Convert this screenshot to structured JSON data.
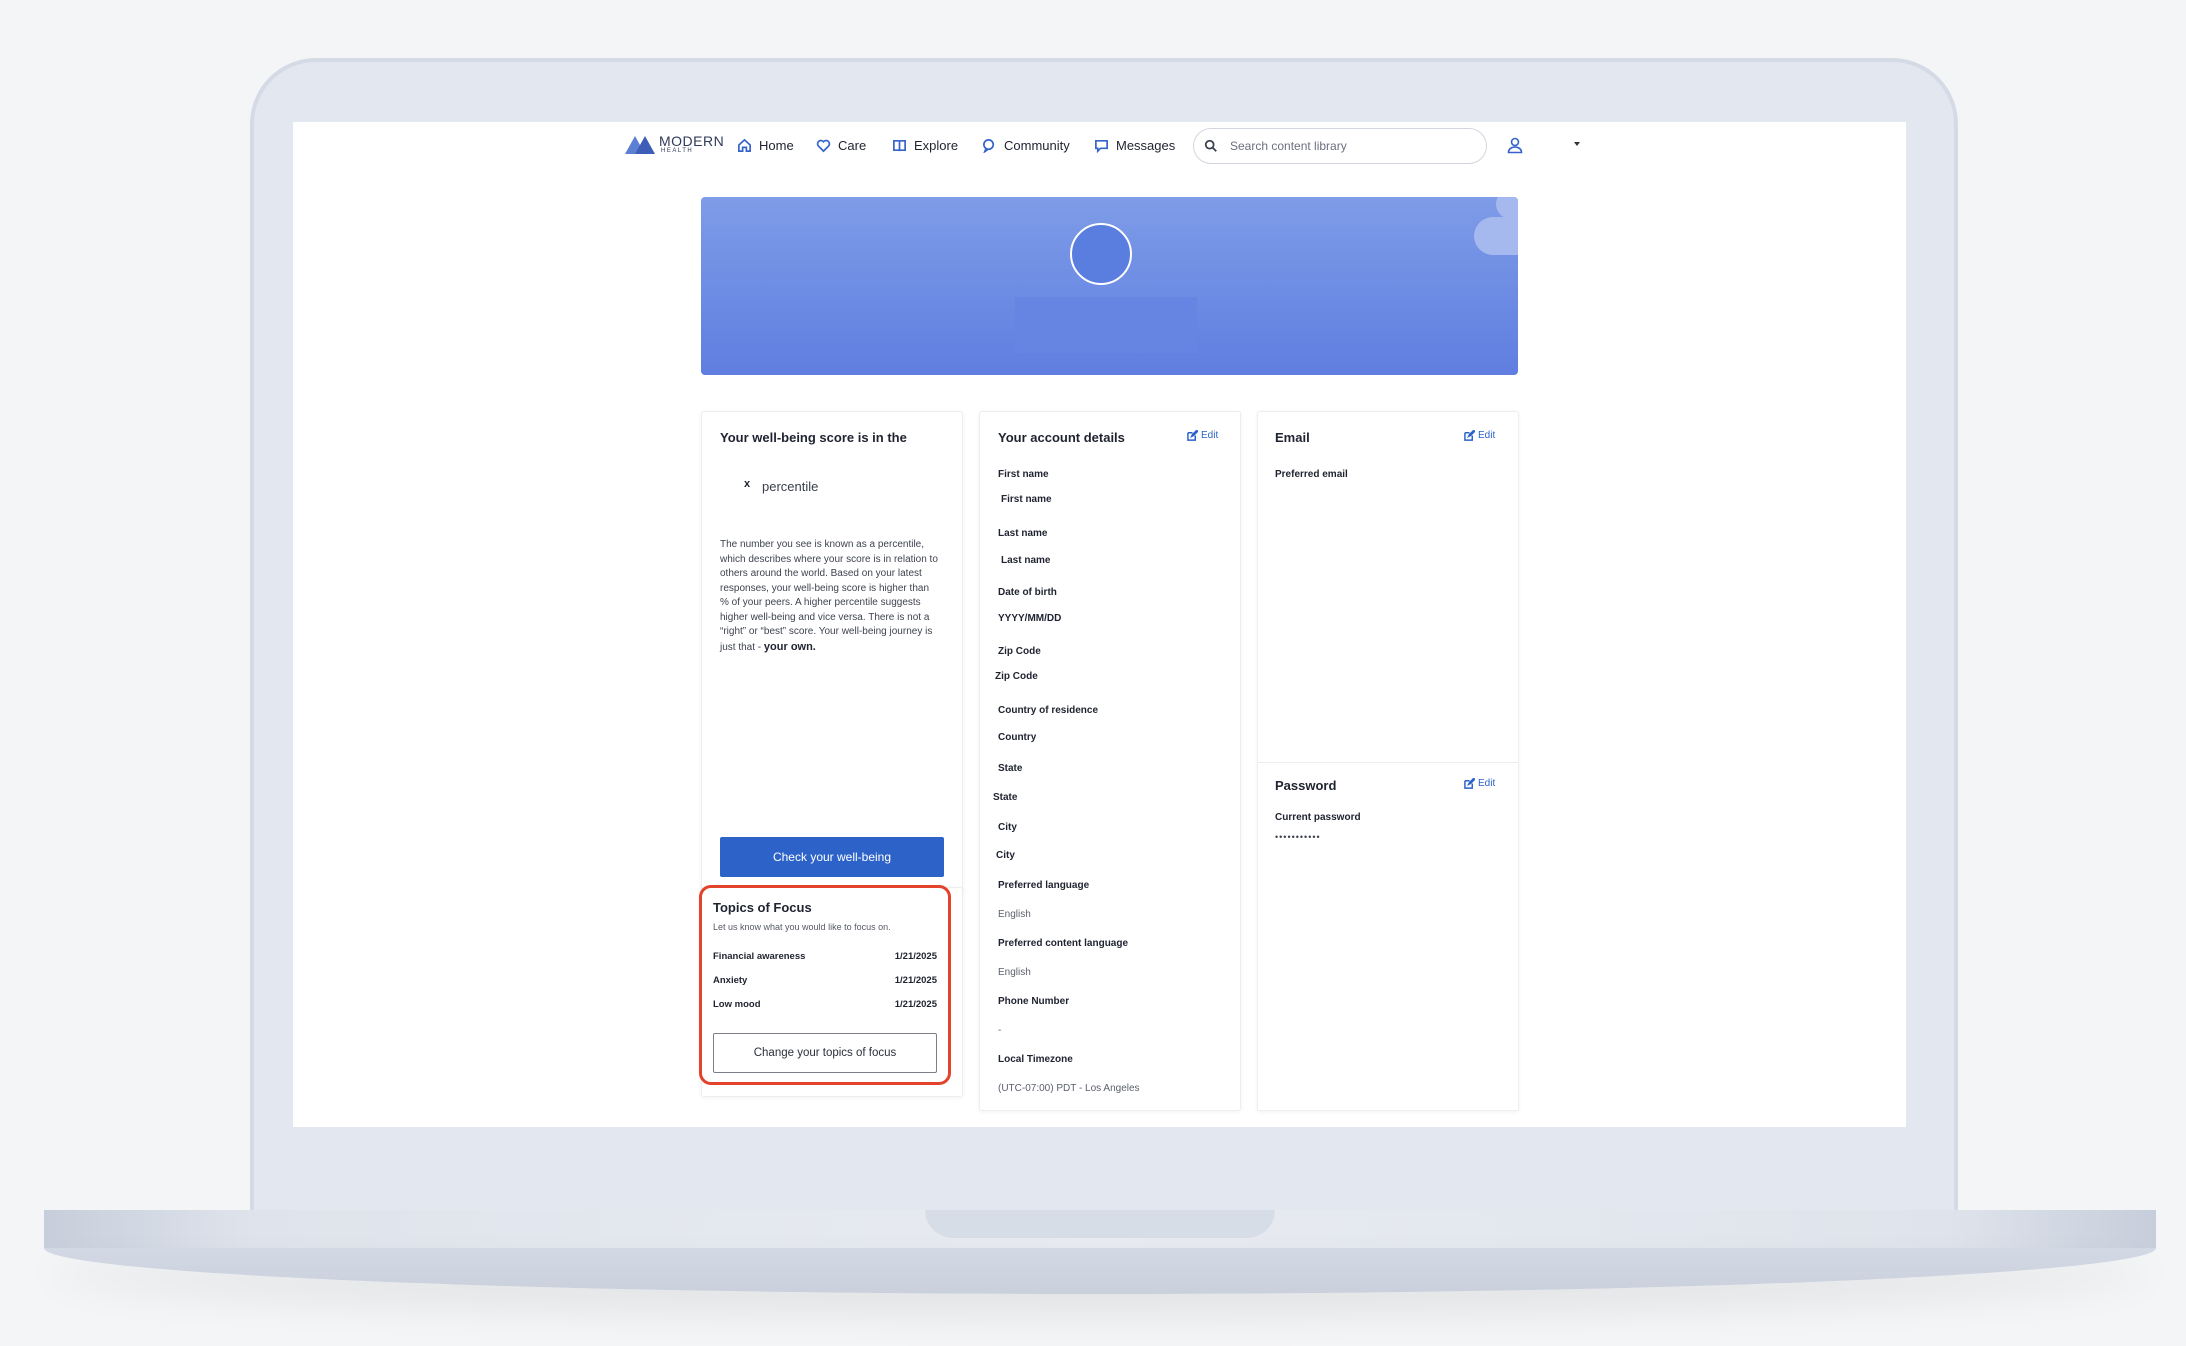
{
  "nav": {
    "logo_line1": "MODERN",
    "logo_line2": "HEALTH",
    "items": [
      {
        "label": "Home",
        "icon": "home-icon"
      },
      {
        "label": "Care",
        "icon": "heart-icon"
      },
      {
        "label": "Explore",
        "icon": "book-icon"
      },
      {
        "label": "Community",
        "icon": "chat-bubbles-icon"
      },
      {
        "label": "Messages",
        "icon": "message-icon"
      }
    ],
    "search_placeholder": "Search content library"
  },
  "wellbeing": {
    "title": "Your well-being score is in the",
    "score": "x",
    "percentile_label": "percentile",
    "desc_1": "The number you see is known as a percentile, which describes where your score is in relation to others around the world. Based on your latest responses, your well-being score is higher than",
    "desc_2": "% of your peers. A higher percentile suggests higher well-being and vice versa. There is not a “right” or “best” score. Your well-being journey is just that -",
    "desc_bold": "your own.",
    "button": "Check your well-being"
  },
  "topics": {
    "title": "Topics of Focus",
    "subtitle": "Let us know what you would like to focus on.",
    "items": [
      {
        "name": "Financial awareness",
        "date": "1/21/2025"
      },
      {
        "name": "Anxiety",
        "date": "1/21/2025"
      },
      {
        "name": "Low mood",
        "date": "1/21/2025"
      }
    ],
    "button": "Change your topics of focus"
  },
  "account": {
    "title": "Your account details",
    "edit": "Edit",
    "fields": [
      {
        "label": "First name",
        "value": "First name"
      },
      {
        "label": "Last name",
        "value": "Last name"
      },
      {
        "label": "Date of birth",
        "value": "YYYY/MM/DD"
      },
      {
        "label": "Zip Code",
        "value": "Zip Code"
      },
      {
        "label": "Country of residence",
        "value": "Country"
      },
      {
        "label": "State",
        "value": "State"
      },
      {
        "label": "City",
        "value": "City"
      },
      {
        "label": "Preferred language",
        "value": "English"
      },
      {
        "label": "Preferred content language",
        "value": "English"
      },
      {
        "label": "Phone Number",
        "value": "-"
      },
      {
        "label": "Local Timezone",
        "value": "(UTC-07:00) PDT - Los Angeles"
      }
    ]
  },
  "email": {
    "title": "Email",
    "edit": "Edit",
    "label": "Preferred email"
  },
  "password": {
    "title": "Password",
    "edit": "Edit",
    "label": "Current password",
    "value": "•••••••••••"
  },
  "colors": {
    "accent": "#2d63c8",
    "highlight": "#e2432a",
    "banner": "#6a88e4"
  }
}
